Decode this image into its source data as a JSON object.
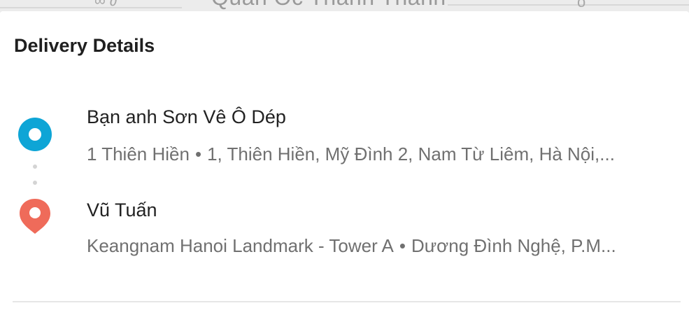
{
  "map": {
    "place_label": "Quán Ốc Thanh Thanh"
  },
  "delivery": {
    "title": "Delivery Details",
    "pickup": {
      "name": "Bạn anh Sơn Vê Ô Dép",
      "address_short": "1 Thiên Hiền",
      "separator": "•",
      "address_full": "1, Thiên Hiền, Mỹ Đình 2, Nam Từ Liêm, Hà Nội,...",
      "icon": "pickup-location-icon",
      "color": "#0ea5d6"
    },
    "dropoff": {
      "name": "Vũ Tuấn",
      "address_short": "Keangnam Hanoi Landmark - Tower A",
      "separator": "•",
      "address_full": "Dương Đình Nghệ, P.M...",
      "icon": "dropoff-pin-icon",
      "color": "#ef6b5a"
    }
  }
}
